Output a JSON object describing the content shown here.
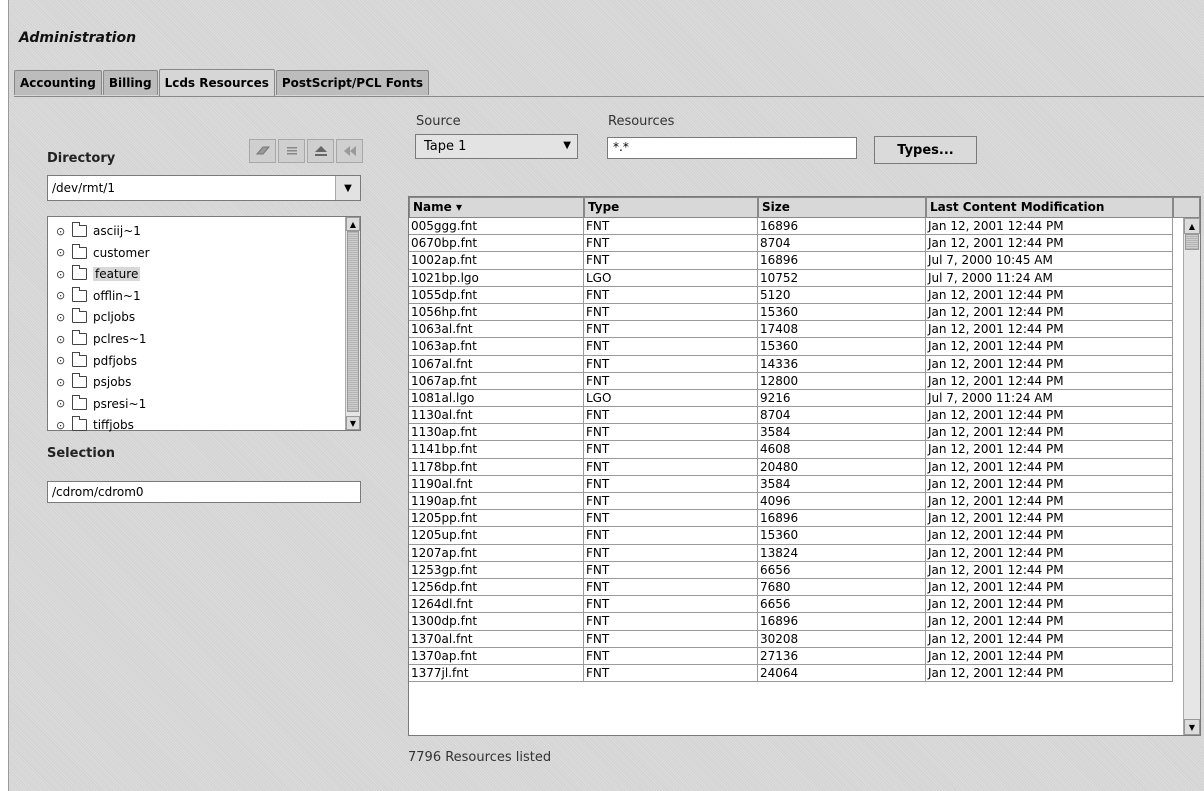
{
  "window": {
    "title": "Administration"
  },
  "tabs": [
    "Accounting",
    "Billing",
    "Lcds Resources",
    "PostScript/PCL Fonts"
  ],
  "active_tab": "Lcds Resources",
  "left_panel": {
    "directory_label": "Directory",
    "directory_value": "/dev/rmt/1",
    "toolbar_icons": [
      "eraser-icon",
      "list-icon",
      "eject-icon",
      "rewind-icon"
    ],
    "tree_items": [
      "asciij~1",
      "customer",
      "feature",
      "offlin~1",
      "pcljobs",
      "pclres~1",
      "pdfjobs",
      "psjobs",
      "psresi~1",
      "tiffjobs"
    ],
    "tree_selected": "feature",
    "selection_label": "Selection",
    "selection_value": "/cdrom/cdrom0"
  },
  "source": {
    "label": "Source",
    "value": "Tape 1"
  },
  "resources": {
    "label": "Resources",
    "value": "*.*"
  },
  "types_button": "Types...",
  "table": {
    "columns": [
      "Name ▾",
      "Type",
      "Size",
      "Last Content Modification"
    ],
    "rows": [
      [
        "005ggg.fnt",
        "FNT",
        "16896",
        "Jan 12, 2001 12:44 PM"
      ],
      [
        "0670bp.fnt",
        "FNT",
        "8704",
        "Jan 12, 2001 12:44 PM"
      ],
      [
        "1002ap.fnt",
        "FNT",
        "16896",
        "Jul 7, 2000 10:45 AM"
      ],
      [
        "1021bp.lgo",
        "LGO",
        "10752",
        "Jul 7, 2000 11:24 AM"
      ],
      [
        "1055dp.fnt",
        "FNT",
        "5120",
        "Jan 12, 2001 12:44 PM"
      ],
      [
        "1056hp.fnt",
        "FNT",
        "15360",
        "Jan 12, 2001 12:44 PM"
      ],
      [
        "1063al.fnt",
        "FNT",
        "17408",
        "Jan 12, 2001 12:44 PM"
      ],
      [
        "1063ap.fnt",
        "FNT",
        "15360",
        "Jan 12, 2001 12:44 PM"
      ],
      [
        "1067al.fnt",
        "FNT",
        "14336",
        "Jan 12, 2001 12:44 PM"
      ],
      [
        "1067ap.fnt",
        "FNT",
        "12800",
        "Jan 12, 2001 12:44 PM"
      ],
      [
        "1081al.lgo",
        "LGO",
        "9216",
        "Jul 7, 2000 11:24 AM"
      ],
      [
        "1130al.fnt",
        "FNT",
        "8704",
        "Jan 12, 2001 12:44 PM"
      ],
      [
        "1130ap.fnt",
        "FNT",
        "3584",
        "Jan 12, 2001 12:44 PM"
      ],
      [
        "1141bp.fnt",
        "FNT",
        "4608",
        "Jan 12, 2001 12:44 PM"
      ],
      [
        "1178bp.fnt",
        "FNT",
        "20480",
        "Jan 12, 2001 12:44 PM"
      ],
      [
        "1190al.fnt",
        "FNT",
        "3584",
        "Jan 12, 2001 12:44 PM"
      ],
      [
        "1190ap.fnt",
        "FNT",
        "4096",
        "Jan 12, 2001 12:44 PM"
      ],
      [
        "1205pp.fnt",
        "FNT",
        "16896",
        "Jan 12, 2001 12:44 PM"
      ],
      [
        "1205up.fnt",
        "FNT",
        "15360",
        "Jan 12, 2001 12:44 PM"
      ],
      [
        "1207ap.fnt",
        "FNT",
        "13824",
        "Jan 12, 2001 12:44 PM"
      ],
      [
        "1253gp.fnt",
        "FNT",
        "6656",
        "Jan 12, 2001 12:44 PM"
      ],
      [
        "1256dp.fnt",
        "FNT",
        "7680",
        "Jan 12, 2001 12:44 PM"
      ],
      [
        "1264dl.fnt",
        "FNT",
        "6656",
        "Jan 12, 2001 12:44 PM"
      ],
      [
        "1300dp.fnt",
        "FNT",
        "16896",
        "Jan 12, 2001 12:44 PM"
      ],
      [
        "1370al.fnt",
        "FNT",
        "30208",
        "Jan 12, 2001 12:44 PM"
      ],
      [
        "1370ap.fnt",
        "FNT",
        "27136",
        "Jan 12, 2001 12:44 PM"
      ],
      [
        "1377jl.fnt",
        "FNT",
        "24064",
        "Jan 12, 2001 12:44 PM"
      ]
    ]
  },
  "status": "7796 Resources listed"
}
